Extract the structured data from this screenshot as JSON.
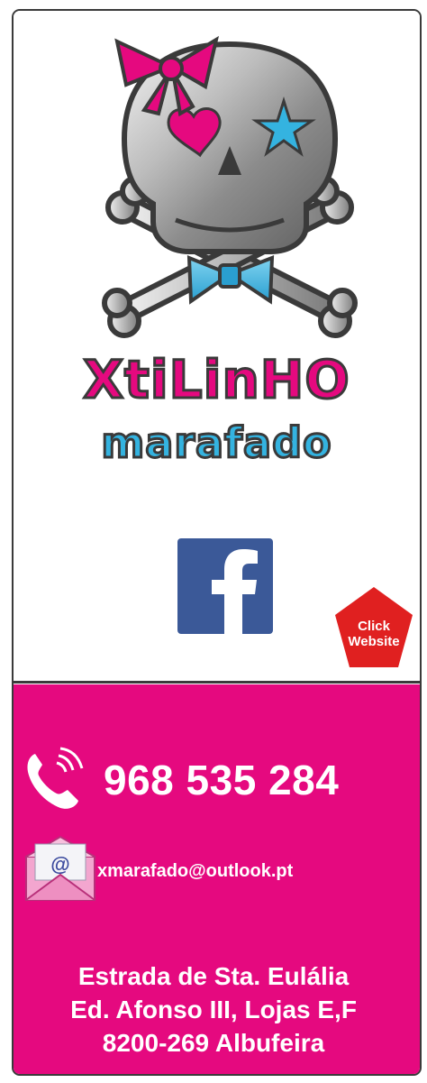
{
  "brand": {
    "line1": "XtiLinHO",
    "line2": "marafado"
  },
  "social": {
    "facebook_letter": "f"
  },
  "website_badge": {
    "line1": "Click",
    "line2": "Website"
  },
  "contact": {
    "phone": "968 535 284",
    "email": "xmarafado@outlook.pt",
    "address": [
      "Estrada de Sta. Eulália",
      "Ed. Afonso III, Lojas E,F",
      "8200-269 Albufeira"
    ]
  },
  "colors": {
    "magenta": "#e5097f",
    "cyan": "#34b3e0",
    "facebook_blue": "#3b5998",
    "badge_red": "#e02020",
    "outline": "#3a3a3a"
  },
  "icons": [
    "skull-logo",
    "bow-icon",
    "heart-icon",
    "star-icon",
    "bowtie-icon",
    "facebook-icon",
    "phone-icon",
    "email-envelope-icon"
  ]
}
